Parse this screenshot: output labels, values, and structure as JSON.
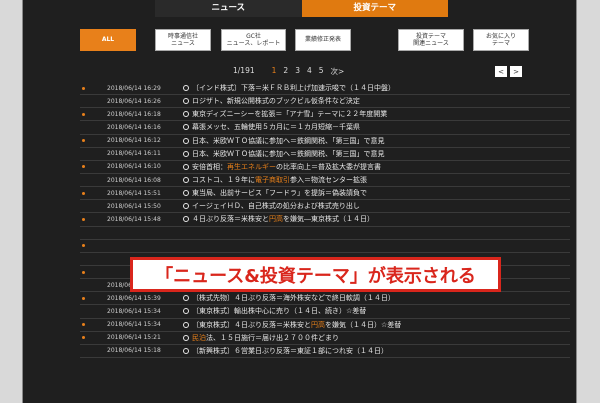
{
  "tabs": [
    {
      "label": "ニュース"
    },
    {
      "label": "投資テーマ"
    }
  ],
  "categories": [
    {
      "label": "ALL"
    },
    {
      "label": "時事通信社\nニュース"
    },
    {
      "label": "GC社\nニュース、レポート"
    },
    {
      "label": "業績修正発表"
    },
    {
      "label": "投資テーマ\n関連ニュース"
    },
    {
      "label": "お気に入り\nテーマ"
    }
  ],
  "pager": {
    "total": "1/191",
    "pages": [
      "1",
      "2",
      "3",
      "4",
      "5"
    ],
    "next": "次>",
    "prev_btn": "<",
    "next_btn": ">"
  },
  "caption": "「ニュース&投資テーマ」が表示される",
  "colors": {
    "accent": "#e8801a",
    "caption_red": "#d9261c",
    "background": "#1f1f1f"
  },
  "news": [
    {
      "date": "2018/06/14 16:29",
      "pre": "〔インド株式〕下落＝米ＦＲＢ利上げ加速示唆で（１４日中盤）",
      "hl": "",
      "post": "",
      "dot": true
    },
    {
      "date": "2018/06/14 16:26",
      "pre": "ロジザト、新規公開株式のブックビル仮条件など決定",
      "hl": "",
      "post": "",
      "dot": false
    },
    {
      "date": "2018/06/14 16:18",
      "pre": "東京ディズニーシーを拡張＝「アナ雪」テーマに２２年度開業",
      "hl": "",
      "post": "",
      "dot": true
    },
    {
      "date": "2018/06/14 16:16",
      "pre": "幕張メッセ、五輪使用５カ月に＝１カ月短縮－千葉県",
      "hl": "",
      "post": "",
      "dot": false
    },
    {
      "date": "2018/06/14 16:12",
      "pre": "日本、米欧ＷＴＯ協議に参加へ＝鉄鋼関税、「第三国」で意見",
      "hl": "",
      "post": "",
      "dot": true
    },
    {
      "date": "2018/06/14 16:11",
      "pre": "日本、米欧ＷＴＯ協議に参加へ＝鉄鋼関税、「第三国」で意見",
      "hl": "",
      "post": "",
      "dot": false
    },
    {
      "date": "2018/06/14 16:10",
      "pre": "安倍首相：",
      "hl": "再生エネルギー",
      "post": "の比率向上＝普及拡大委が提言書",
      "dot": true
    },
    {
      "date": "2018/06/14 16:08",
      "pre": "コストコ、１９年に",
      "hl": "電子商取引",
      "post": "参入＝物流センター拡張",
      "dot": false
    },
    {
      "date": "2018/06/14 15:51",
      "pre": "東当局、出前サービス「フードラ」を提訴＝偽装請負で",
      "hl": "",
      "post": "",
      "dot": true
    },
    {
      "date": "2018/06/14 15:50",
      "pre": "イージェイＨＤ、自己株式の処分および株式売り出し",
      "hl": "",
      "post": "",
      "dot": false
    },
    {
      "date": "2018/06/14 15:48",
      "pre": "４日ぶり反落＝米株安と",
      "hl": "円高",
      "post": "を嫌気―東京株式（１４日）",
      "dot": true
    },
    {
      "date": "",
      "pre": "",
      "hl": "",
      "post": "",
      "dot": false
    },
    {
      "date": "",
      "pre": "",
      "hl": "",
      "post": "",
      "dot": true
    },
    {
      "date": "",
      "pre": "",
      "hl": "",
      "post": "",
      "dot": false
    },
    {
      "date": "",
      "pre": "",
      "hl": "",
      "post": "",
      "dot": true
    },
    {
      "date": "2018/06/14 15:39",
      "pre": "〔株式オプション〕プット上伸、コール軟化（１４日）",
      "hl": "",
      "post": "",
      "dot": false
    },
    {
      "date": "2018/06/14 15:39",
      "pre": "〔株式先物〕４日ぶり反落＝海外株安などで終日軟調（１４日）",
      "hl": "",
      "post": "",
      "dot": true
    },
    {
      "date": "2018/06/14 15:34",
      "pre": "〔東京株式〕輸出株中心に売り（１４日、続き）☆差替",
      "hl": "",
      "post": "",
      "dot": false
    },
    {
      "date": "2018/06/14 15:34",
      "pre": "〔東京株式〕４日ぶり反落＝米株安と",
      "hl": "円高",
      "post": "を嫌気（１４日）☆差替",
      "dot": true
    },
    {
      "date": "2018/06/14 15:21",
      "pre": "",
      "hl": "民泊",
      "post": "法、１５日施行＝届け出２７００件どまり",
      "dot": true
    },
    {
      "date": "2018/06/14 15:18",
      "pre": "〔新興株式〕６営業日ぶり反落＝東証１部につれ安（１４日）",
      "hl": "",
      "post": "",
      "dot": false
    }
  ]
}
